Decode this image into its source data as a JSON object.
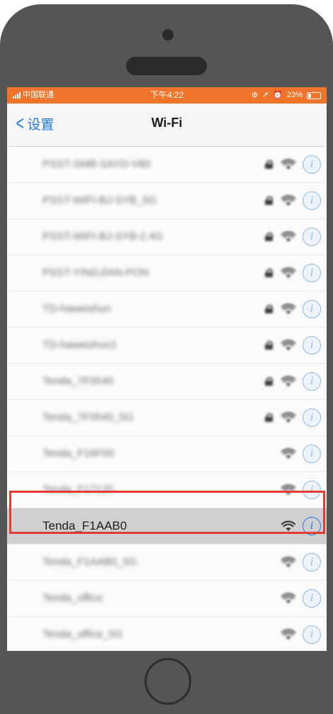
{
  "status_bar": {
    "carrier": "中国联通",
    "time": "下午4:22",
    "battery": "23%",
    "background_color": "#f0742a"
  },
  "nav_bar": {
    "back_label": "设置",
    "title": "Wi-Fi"
  },
  "networks": [
    {
      "name": "PSST-SMB-SAYD-V80",
      "locked": true,
      "signal_icon": "wifi-icon",
      "selected": false
    },
    {
      "name": "PSST-WIFI-BJ-SYB_5G",
      "locked": true,
      "signal_icon": "wifi-icon",
      "selected": false
    },
    {
      "name": "PSST-WIFI-BJ-SYB-2.4G",
      "locked": true,
      "signal_icon": "wifi-icon",
      "selected": false
    },
    {
      "name": "PSST-YINGJIAN-PON",
      "locked": true,
      "signal_icon": "wifi-icon",
      "selected": false
    },
    {
      "name": "TD-haweishun",
      "locked": true,
      "signal_icon": "wifi-icon",
      "selected": false
    },
    {
      "name": "TD-haweishun1",
      "locked": true,
      "signal_icon": "wifi-icon",
      "selected": false
    },
    {
      "name": "Tenda_7F0540",
      "locked": true,
      "signal_icon": "wifi-icon",
      "selected": false
    },
    {
      "name": "Tenda_7F0540_5G",
      "locked": true,
      "signal_icon": "wifi-icon",
      "selected": false
    },
    {
      "name": "Tenda_F16F00",
      "locked": false,
      "signal_icon": "wifi-icon",
      "selected": false
    },
    {
      "name": "Tenda_F17120",
      "locked": false,
      "signal_icon": "wifi-icon",
      "selected": false
    },
    {
      "name": "Tenda_F1AAB0",
      "locked": false,
      "signal_icon": "wifi-icon",
      "selected": true
    },
    {
      "name": "Tenda_F1AAB0_5G",
      "locked": false,
      "signal_icon": "wifi-icon",
      "selected": false
    },
    {
      "name": "Tenda_office",
      "locked": false,
      "signal_icon": "wifi-icon",
      "selected": false
    },
    {
      "name": "Tenda_office_5G",
      "locked": false,
      "signal_icon": "wifi-icon",
      "selected": false
    }
  ],
  "info_glyph": "i",
  "highlight_color": "#e53c32",
  "accent_color": "#1f7ae0"
}
